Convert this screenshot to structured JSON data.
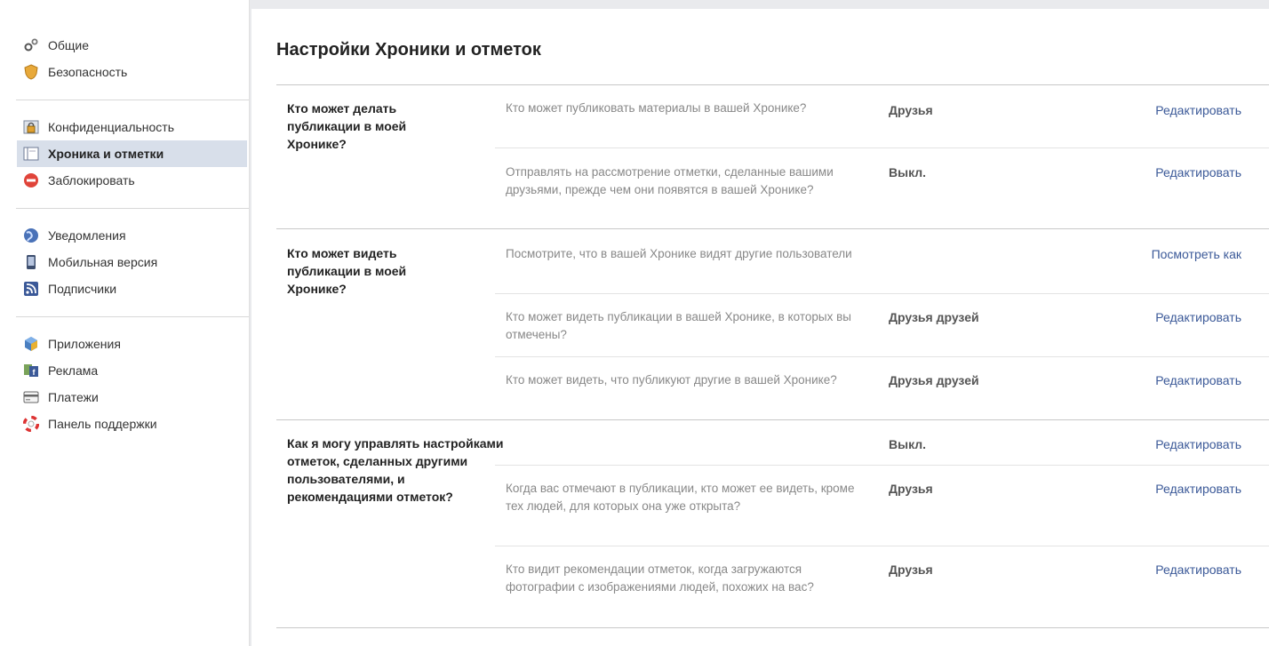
{
  "sidebar": {
    "group1": [
      {
        "label": "Общие",
        "icon": "gears-icon"
      },
      {
        "label": "Безопасность",
        "icon": "shield-icon"
      }
    ],
    "group2": [
      {
        "label": "Конфиденциальность",
        "icon": "lock-icon"
      },
      {
        "label": "Хроника и отметки",
        "icon": "timeline-icon",
        "selected": true
      },
      {
        "label": "Заблокировать",
        "icon": "block-icon"
      }
    ],
    "group3": [
      {
        "label": "Уведомления",
        "icon": "globe-icon"
      },
      {
        "label": "Мобильная версия",
        "icon": "mobile-icon"
      },
      {
        "label": "Подписчики",
        "icon": "rss-icon"
      }
    ],
    "group4": [
      {
        "label": "Приложения",
        "icon": "apps-cube-icon"
      },
      {
        "label": "Реклама",
        "icon": "ads-icon"
      },
      {
        "label": "Платежи",
        "icon": "card-icon"
      },
      {
        "label": "Панель поддержки",
        "icon": "lifebuoy-icon"
      }
    ]
  },
  "main": {
    "title": "Настройки Хроники и отметок",
    "sections": [
      {
        "title": "Кто может делать публикации в моей Хронике?",
        "rows": [
          {
            "question": "Кто может публиковать материалы в вашей Хронике?",
            "value": "Друзья",
            "action": "Редактировать"
          },
          {
            "question": "Отправлять на рассмотрение отметки, сделанные вашими друзьями, прежде чем они появятся в вашей Хронике?",
            "value": "Выкл.",
            "action": "Редактировать"
          }
        ]
      },
      {
        "title": "Кто может видеть публикации в моей Хронике?",
        "rows": [
          {
            "question": "Посмотрите, что в вашей Хронике видят другие пользователи",
            "value": "",
            "action": "Посмотреть как"
          },
          {
            "question": "Кто может видеть публикации в вашей Хронике, в которых вы отмечены?",
            "value": "Друзья друзей",
            "action": "Редактировать"
          },
          {
            "question": "Кто может видеть, что публикуют другие в вашей Хронике?",
            "value": "Друзья друзей",
            "action": "Редактировать"
          }
        ]
      },
      {
        "title": "Как я могу управлять настройками отметок, сделанных другими пользователями, и рекомендациями отметок?",
        "rows": [
          {
            "question": "",
            "value": "Выкл.",
            "action": "Редактировать"
          },
          {
            "question": "Когда вас отмечают в публикации, кто может ее видеть, кроме тех людей, для которых она уже открыта?",
            "value": "Друзья",
            "action": "Редактировать"
          },
          {
            "question": "Кто видит рекомендации отметок, когда загружаются фотографии с изображениями людей, похожих на вас?",
            "value": "Друзья",
            "action": "Редактировать"
          }
        ]
      }
    ]
  }
}
